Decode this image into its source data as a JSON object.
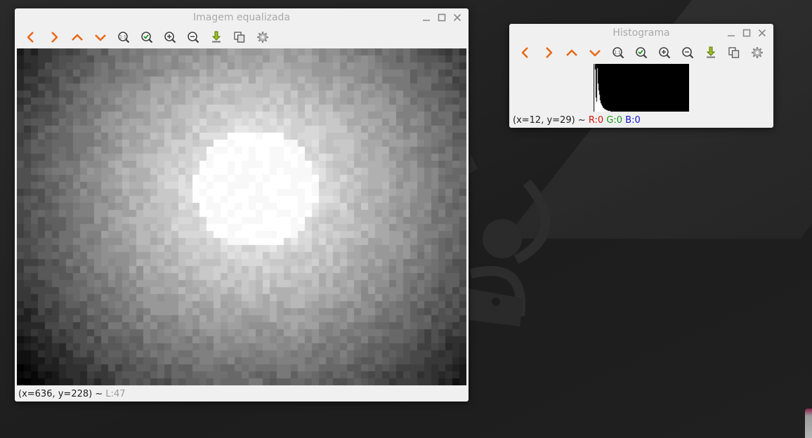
{
  "windows": {
    "equalized": {
      "title": "Imagem equalizada",
      "status": {
        "coords": "(x=636, y=228)",
        "sep": " ~ ",
        "level": "L:47"
      }
    },
    "histogram": {
      "title": "Histograma",
      "status": {
        "coords": "(x=12, y=29)",
        "sep": " ~ ",
        "r": "R:0",
        "g": "G:0",
        "b": "B:0"
      }
    }
  },
  "toolbar_icons": [
    "pan-left-icon",
    "pan-right-icon",
    "pan-up-icon",
    "pan-down-icon",
    "zoom-fit-icon",
    "zoom-reset-icon",
    "zoom-in-icon",
    "zoom-out-icon",
    "save-icon",
    "copy-icon",
    "properties-icon"
  ],
  "colors": {
    "arrow": "#e86a1a",
    "check": "#2e9a2e",
    "save": "#9ac020",
    "status_red": "#d9140a",
    "status_green": "#1a9a1a",
    "status_blue": "#1414d2"
  }
}
